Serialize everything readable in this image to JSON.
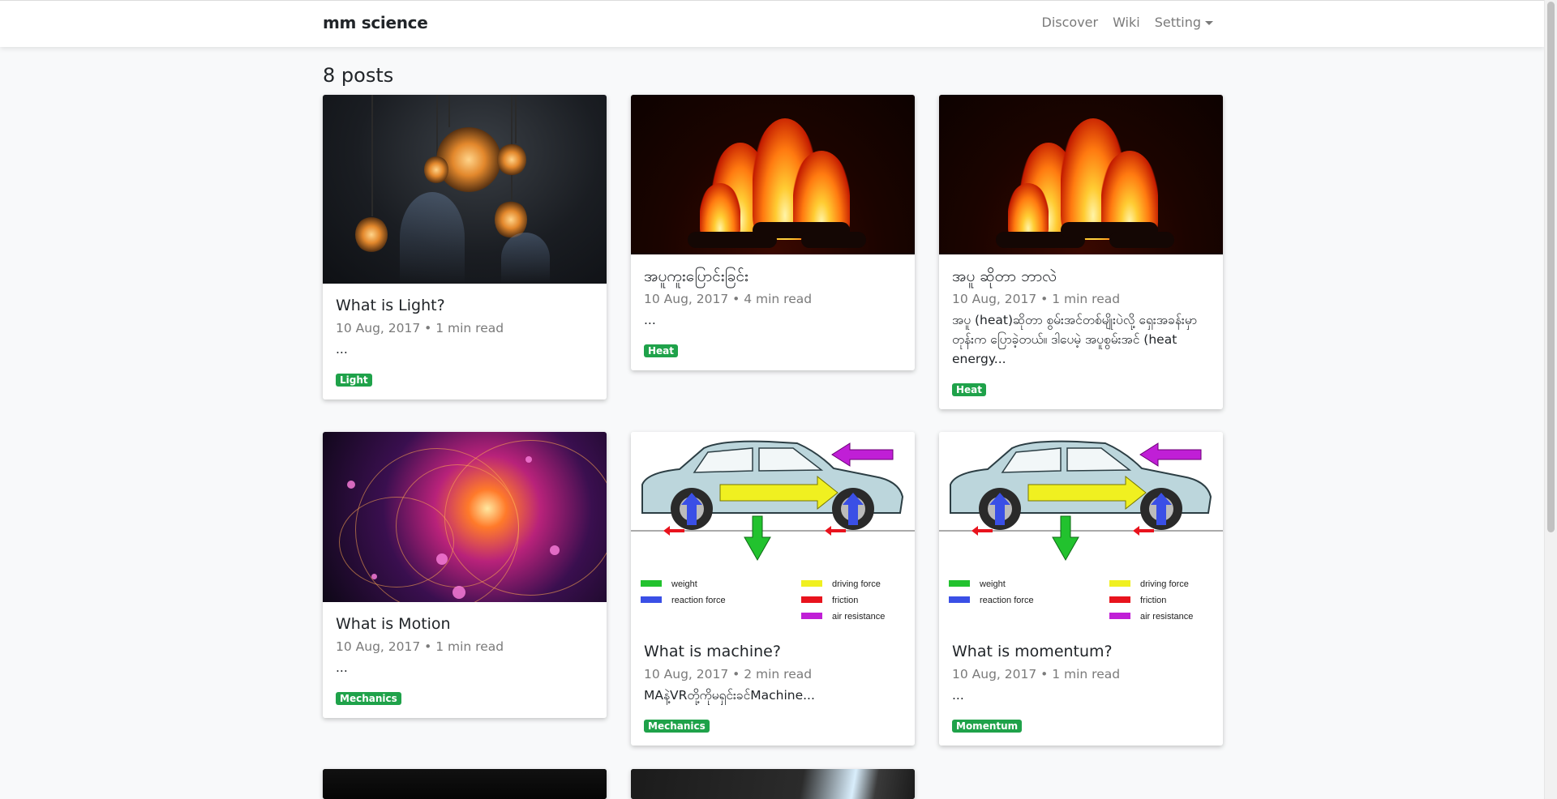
{
  "nav": {
    "brand": "mm science",
    "links": [
      "Discover",
      "Wiki",
      "Setting"
    ]
  },
  "heading": "8 posts",
  "posts": [
    {
      "title": "What is Light?",
      "meta": "10 Aug, 2017 • 1 min read",
      "excerpt": "...",
      "tag": "Light",
      "image": "hanging-light-bulbs"
    },
    {
      "title": "အပူကူးပြောင်းခြင်း",
      "meta": "10 Aug, 2017 • 4 min read",
      "excerpt": "...",
      "tag": "Heat",
      "image": "fireplace"
    },
    {
      "title": "အပူ ဆိုတာ ဘာလဲ",
      "meta": "10 Aug, 2017 • 1 min read",
      "excerpt": "အပူ (heat)ဆိုတာ စွမ်းအင်တစ်မျိုးပဲလို့ ရှေးအခန်းမှာတုန်းက ပြောခဲ့တယ်။ ဒါပေမဲ့ အပူစွမ်းအင် (heat energy...",
      "tag": "Heat",
      "image": "fireplace"
    },
    {
      "title": "What is Motion",
      "meta": "10 Aug, 2017 • 1 min read",
      "excerpt": "...",
      "tag": "Mechanics",
      "image": "particle-orbits"
    },
    {
      "title": "What is machine?",
      "meta": "10 Aug, 2017 • 2 min read",
      "excerpt": "MAနဲ့VRတို့ကိုမရှင်းခင်Machine...",
      "tag": "Mechanics",
      "image": "car-forces-diagram"
    },
    {
      "title": "What is momentum?",
      "meta": "10 Aug, 2017 • 1 min read",
      "excerpt": "...",
      "tag": "Momentum",
      "image": "car-forces-diagram"
    }
  ],
  "diagram_legend": {
    "weight": "weight",
    "reaction": "reaction force",
    "driving": "driving force",
    "friction": "friction",
    "air": "air resistance"
  },
  "colors": {
    "badge": "#1fa24a",
    "weight": "#22c22e",
    "reaction": "#3a4fe6",
    "driving": "#f0f020",
    "friction": "#e8131d",
    "air": "#c01fd6"
  }
}
